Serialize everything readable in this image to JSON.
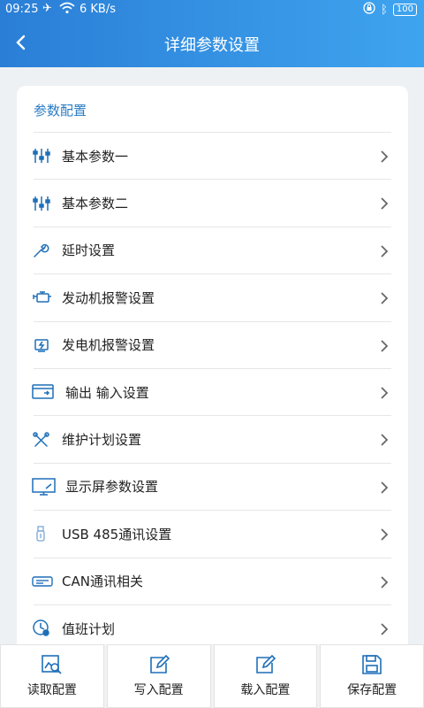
{
  "status_bar": {
    "time": "09:25",
    "network": "6 KB/s",
    "battery": "100"
  },
  "header": {
    "title": "详细参数设置"
  },
  "section": {
    "title": "参数配置"
  },
  "menu": [
    {
      "label": "基本参数一",
      "icon": "sliders-icon"
    },
    {
      "label": "基本参数二",
      "icon": "sliders-icon"
    },
    {
      "label": "延时设置",
      "icon": "wrench-icon"
    },
    {
      "label": "发动机报警设置",
      "icon": "engine-icon"
    },
    {
      "label": "发电机报警设置",
      "icon": "generator-icon"
    },
    {
      "label": "输出 输入设置",
      "icon": "io-icon"
    },
    {
      "label": "维护计划设置",
      "icon": "tools-icon"
    },
    {
      "label": "显示屏参数设置",
      "icon": "monitor-icon"
    },
    {
      "label": "USB 485通讯设置",
      "icon": "usb-icon"
    },
    {
      "label": "CAN通讯相关",
      "icon": "can-icon"
    },
    {
      "label": "值班计划",
      "icon": "schedule-icon"
    }
  ],
  "bottom_tabs": [
    {
      "label": "读取配置",
      "icon": "read-config-icon"
    },
    {
      "label": "写入配置",
      "icon": "write-config-icon"
    },
    {
      "label": "载入配置",
      "icon": "load-config-icon"
    },
    {
      "label": "保存配置",
      "icon": "save-config-icon"
    }
  ],
  "colors": {
    "header_start": "#2a7ed6",
    "header_end": "#3fa4ef",
    "accent": "#2a7cc4",
    "icon": "#1e6fb8"
  }
}
